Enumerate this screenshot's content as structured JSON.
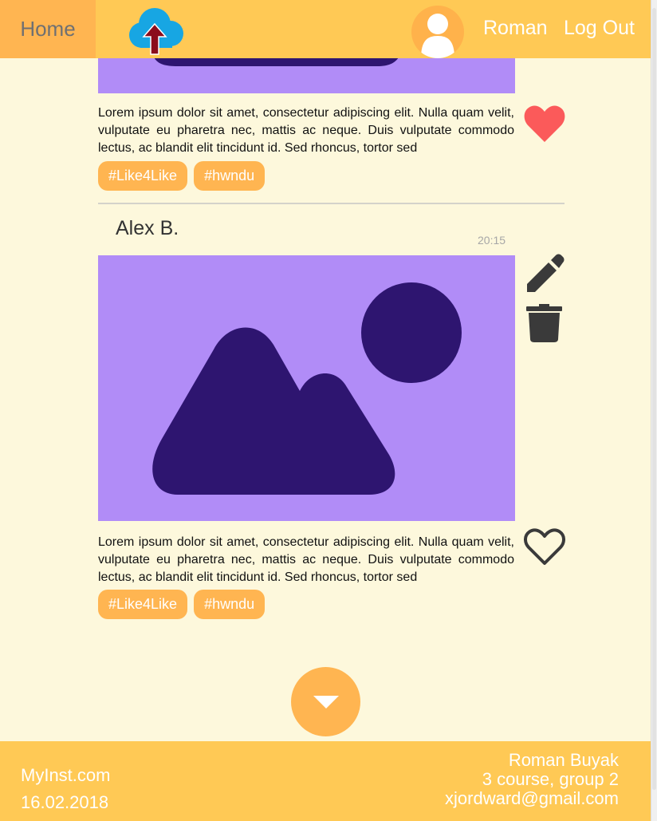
{
  "header": {
    "home_label": "Home",
    "username": "Roman",
    "logout_label": "Log Out"
  },
  "posts": [
    {
      "text": "Lorem ipsum dolor sit amet, consectetur adipiscing elit. Nulla quam velit, vulputate eu pharetra nec, mattis ac neque. Duis vulputate commodo lectus, ac blandit elit tincidunt id. Sed rhoncus, tortor sed",
      "tags": [
        "#Like4Like",
        "#hwndu"
      ],
      "liked": true
    },
    {
      "author": "Alex B.",
      "time": "20:15",
      "text": "Lorem ipsum dolor sit amet, consectetur adipiscing elit. Nulla quam velit, vulputate eu pharetra nec, mattis ac neque. Duis vulputate commodo lectus, ac blandit elit tincidunt id. Sed rhoncus, tortor sed",
      "tags": [
        "#Like4Like",
        "#hwndu"
      ],
      "liked": false
    }
  ],
  "footer": {
    "site": "MyInst.com",
    "date": "16.02.2018",
    "author_name": "Roman Buyak",
    "course": "3 course, group 2",
    "email": "xjordward@gmail.com"
  },
  "colors": {
    "background": "#fdf8dc",
    "header": "#ffc955",
    "accent": "#ffb551",
    "image_bg": "#b18cf7",
    "image_fg": "#2e1570",
    "like": "#fb5a5a",
    "icon_dark": "#3a3a3a"
  },
  "icons": {
    "upload": "cloud-upload-icon",
    "avatar": "user-avatar-icon",
    "like_filled": "heart-filled-icon",
    "like_outline": "heart-outline-icon",
    "edit": "pencil-icon",
    "delete": "trash-icon",
    "load_more": "chevron-down-icon"
  }
}
